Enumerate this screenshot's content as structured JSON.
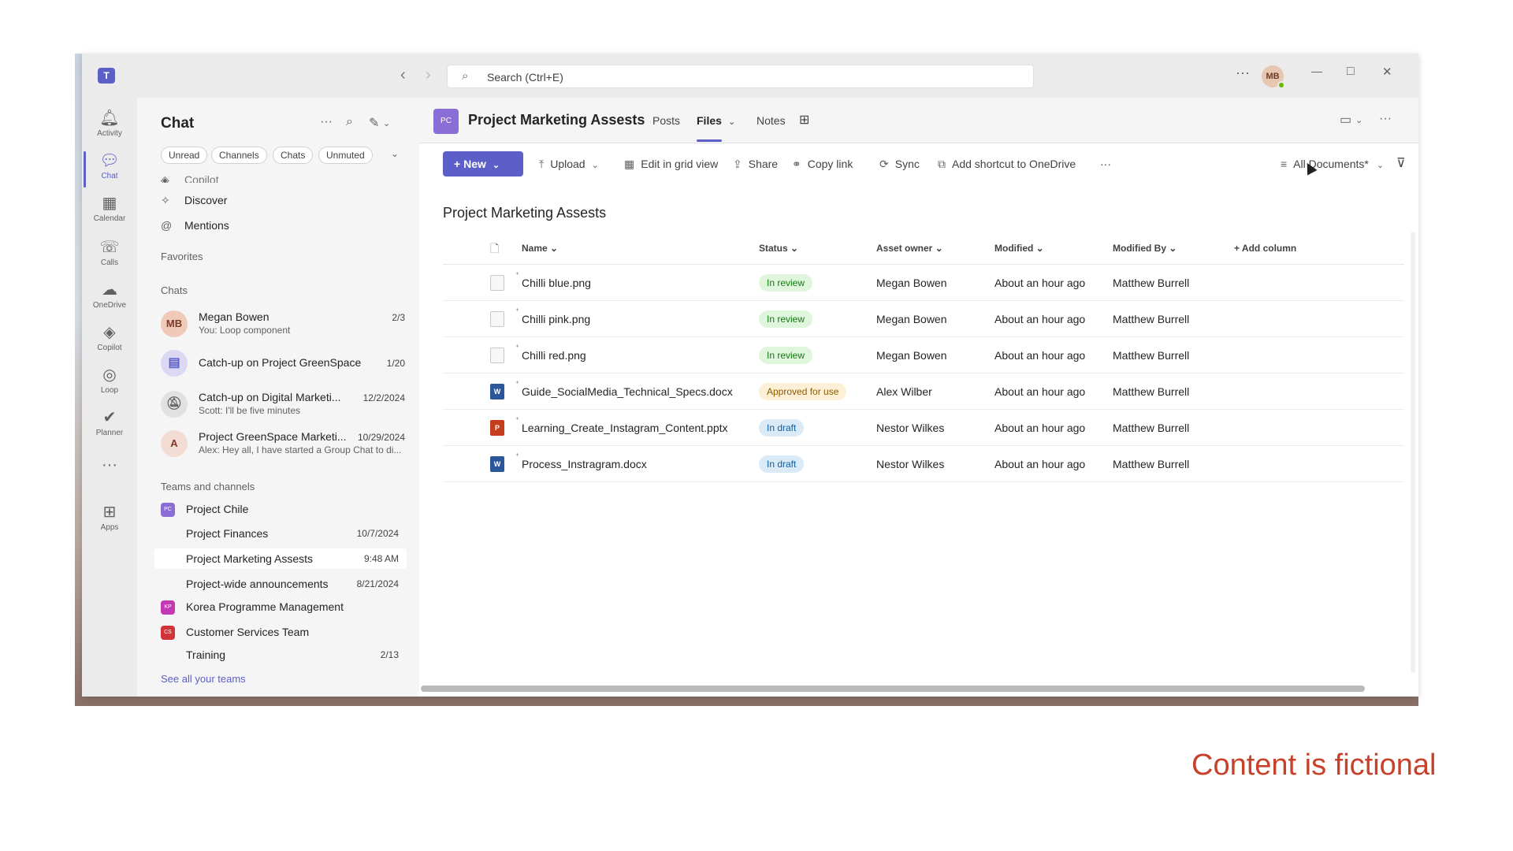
{
  "titlebar": {
    "search_placeholder": "Search (Ctrl+E)",
    "avatar_initials": "MB",
    "more": "···",
    "minimize": "—",
    "maximize": "□",
    "close": "✕"
  },
  "rail": [
    {
      "label": "Activity",
      "icon": "bell-icon"
    },
    {
      "label": "Chat",
      "icon": "chat-icon"
    },
    {
      "label": "Calendar",
      "icon": "calendar-icon"
    },
    {
      "label": "Calls",
      "icon": "phone-icon"
    },
    {
      "label": "OneDrive",
      "icon": "cloud-icon"
    },
    {
      "label": "Copilot",
      "icon": "copilot-icon"
    },
    {
      "label": "Loop",
      "icon": "loop-icon"
    },
    {
      "label": "Planner",
      "icon": "planner-icon"
    },
    {
      "label": "Apps",
      "icon": "plus-square-icon"
    }
  ],
  "chatpane": {
    "title": "Chat",
    "filters": [
      "Unread",
      "Channels",
      "Chats",
      "Unmuted"
    ],
    "nav": [
      {
        "label": "Copilot"
      },
      {
        "label": "Discover"
      },
      {
        "label": "Mentions"
      }
    ],
    "favorites_label": "Favorites",
    "chats_label": "Chats",
    "chats": [
      {
        "avatar": "MB",
        "name": "Megan Bowen",
        "preview": "You: Loop component",
        "date": "2/3"
      },
      {
        "avatar": "",
        "name": "Catch-up on Project GreenSpace",
        "preview": "",
        "date": "1/20"
      },
      {
        "avatar": "",
        "name": "Catch-up on Digital Marketi...",
        "preview": "Scott: I'll be five minutes",
        "date": "12/2/2024"
      },
      {
        "avatar": "A",
        "name": "Project GreenSpace Marketi...",
        "preview": "Alex: Hey all, I have started a Group Chat to di...",
        "date": "10/29/2024"
      }
    ],
    "teams_label": "Teams and channels",
    "teams": [
      {
        "name": "Project Chile",
        "color": "#8b6dd6",
        "initials": "PC"
      },
      {
        "name": "Korea Programme Management",
        "color": "#c239b3",
        "initials": "KP"
      },
      {
        "name": "Customer Services Team",
        "color": "#d13438",
        "initials": "CS"
      }
    ],
    "channels": [
      {
        "name": "Project Finances",
        "date": "10/7/2024"
      },
      {
        "name": "Project Marketing Assests",
        "date": "9:48 AM"
      },
      {
        "name": "Project-wide announcements",
        "date": "8/21/2024"
      },
      {
        "name": "Training",
        "date": "2/13"
      }
    ],
    "see_all": "See all your teams"
  },
  "channel": {
    "avatar": "PC",
    "title": "Project Marketing Assests",
    "tabs": [
      "Posts",
      "Files",
      "Notes"
    ]
  },
  "commands": {
    "new": "New",
    "upload": "Upload",
    "grid": "Edit in grid view",
    "share": "Share",
    "copy_link": "Copy link",
    "sync": "Sync",
    "shortcut": "Add shortcut to OneDrive",
    "more": "···",
    "view": "All Documents*"
  },
  "library_title": "Project Marketing Assests",
  "table": {
    "headers": {
      "name": "Name",
      "status": "Status",
      "owner": "Asset owner",
      "modified": "Modified",
      "modified_by": "Modified By",
      "add_column": "Add column"
    },
    "rows": [
      {
        "type": "img",
        "name": "Chilli blue.png",
        "status": "In review",
        "status_kind": "review",
        "owner": "Megan Bowen",
        "modified": "About an hour ago",
        "modified_by": "Matthew Burrell"
      },
      {
        "type": "img",
        "name": "Chilli pink.png",
        "status": "In review",
        "status_kind": "review",
        "owner": "Megan Bowen",
        "modified": "About an hour ago",
        "modified_by": "Matthew Burrell"
      },
      {
        "type": "img",
        "name": "Chilli red.png",
        "status": "In review",
        "status_kind": "review",
        "owner": "Megan Bowen",
        "modified": "About an hour ago",
        "modified_by": "Matthew Burrell"
      },
      {
        "type": "docx",
        "name": "Guide_SocialMedia_Technical_Specs.docx",
        "status": "Approved for use",
        "status_kind": "approved",
        "owner": "Alex Wilber",
        "modified": "About an hour ago",
        "modified_by": "Matthew Burrell"
      },
      {
        "type": "pptx",
        "name": "Learning_Create_Instagram_Content.pptx",
        "status": "In draft",
        "status_kind": "draft",
        "owner": "Nestor Wilkes",
        "modified": "About an hour ago",
        "modified_by": "Matthew Burrell"
      },
      {
        "type": "docx",
        "name": "Process_Instragram.docx",
        "status": "In draft",
        "status_kind": "draft",
        "owner": "Nestor Wilkes",
        "modified": "About an hour ago",
        "modified_by": "Matthew Burrell"
      }
    ]
  },
  "footnote": "Content is fictional"
}
